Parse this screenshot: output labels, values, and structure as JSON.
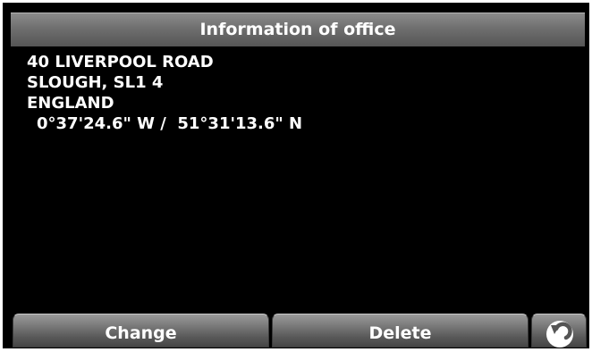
{
  "header": {
    "title": "Information of office"
  },
  "address": {
    "line1": "40 LIVERPOOL ROAD",
    "line2": "SLOUGH, SL1 4",
    "line3": "ENGLAND",
    "coordinates": "0°37'24.6\" W /  51°31'13.6\" N"
  },
  "buttons": {
    "change_label": "Change",
    "delete_label": "Delete",
    "back_icon": "back-arrow-icon"
  }
}
